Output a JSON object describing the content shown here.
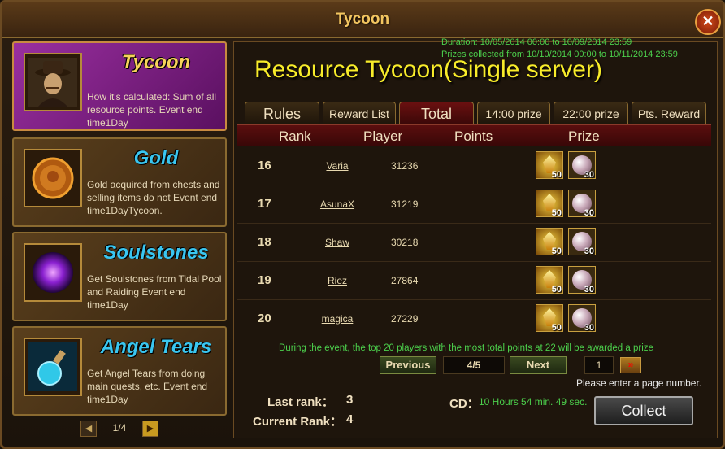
{
  "window": {
    "title": "Tycoon",
    "close": "✕"
  },
  "sidebar": {
    "cards": [
      {
        "name": "Tycoon",
        "desc": "How it's calculated: Sum of all resource points. Event end time1Day",
        "icon": "tycoon-portrait-icon"
      },
      {
        "name": "Gold",
        "desc": "Gold acquired from chests and selling items do not Event end time1DayTycoon.",
        "icon": "gold-coin-icon"
      },
      {
        "name": "Soulstones",
        "desc": "Get Soulstones from Tidal Pool and Raiding Event end time1Day",
        "icon": "soulstone-orb-icon"
      },
      {
        "name": "Angel Tears",
        "desc": "Get Angel Tears from doing main quests, etc. Event end time1Day",
        "icon": "angel-tears-potion-icon"
      }
    ],
    "pager": {
      "text": "1/4",
      "prev": "◀",
      "next": "▶"
    }
  },
  "header": {
    "duration": "Duration: 10/05/2014 00:00 to 10/09/2014 23:59",
    "prizes": "Prizes collected from 10/10/2014 00:00 to 10/11/2014 23:59",
    "title": "Resource Tycoon(Single server)"
  },
  "tabs": [
    {
      "label": "Rules"
    },
    {
      "label": "Reward List"
    },
    {
      "label": "Total"
    },
    {
      "label": "14:00 prize"
    },
    {
      "label": "22:00 prize"
    },
    {
      "label": "Pts. Reward"
    }
  ],
  "table": {
    "headers": {
      "rank": "Rank",
      "player": "Player",
      "points": "Points",
      "prize": "Prize"
    },
    "rows": [
      {
        "rank": "16",
        "player": "Varia",
        "points": "31236",
        "prize1_qty": "50",
        "prize2_qty": "30"
      },
      {
        "rank": "17",
        "player": "AsunaX",
        "points": "31219",
        "prize1_qty": "50",
        "prize2_qty": "30"
      },
      {
        "rank": "18",
        "player": "Shaw",
        "points": "30218",
        "prize1_qty": "50",
        "prize2_qty": "30"
      },
      {
        "rank": "19",
        "player": "Riez",
        "points": "27864",
        "prize1_qty": "50",
        "prize2_qty": "30"
      },
      {
        "rank": "20",
        "player": "magica",
        "points": "27229",
        "prize1_qty": "50",
        "prize2_qty": "30"
      }
    ]
  },
  "notice": "During the event, the top 20 players with the most total points at 22 will be awarded a prize",
  "pagination": {
    "prev": "Previous",
    "page": "4/5",
    "next": "Next",
    "input_value": "1",
    "go": "»",
    "hint": "Please enter a page number."
  },
  "footer": {
    "last_rank_label": "Last rank：",
    "last_rank_value": "3",
    "current_rank_label": "Current Rank：",
    "current_rank_value": "4",
    "cd_label": "CD：",
    "cd_value": "10 Hours 54 min. 49 sec.",
    "collect": "Collect"
  }
}
